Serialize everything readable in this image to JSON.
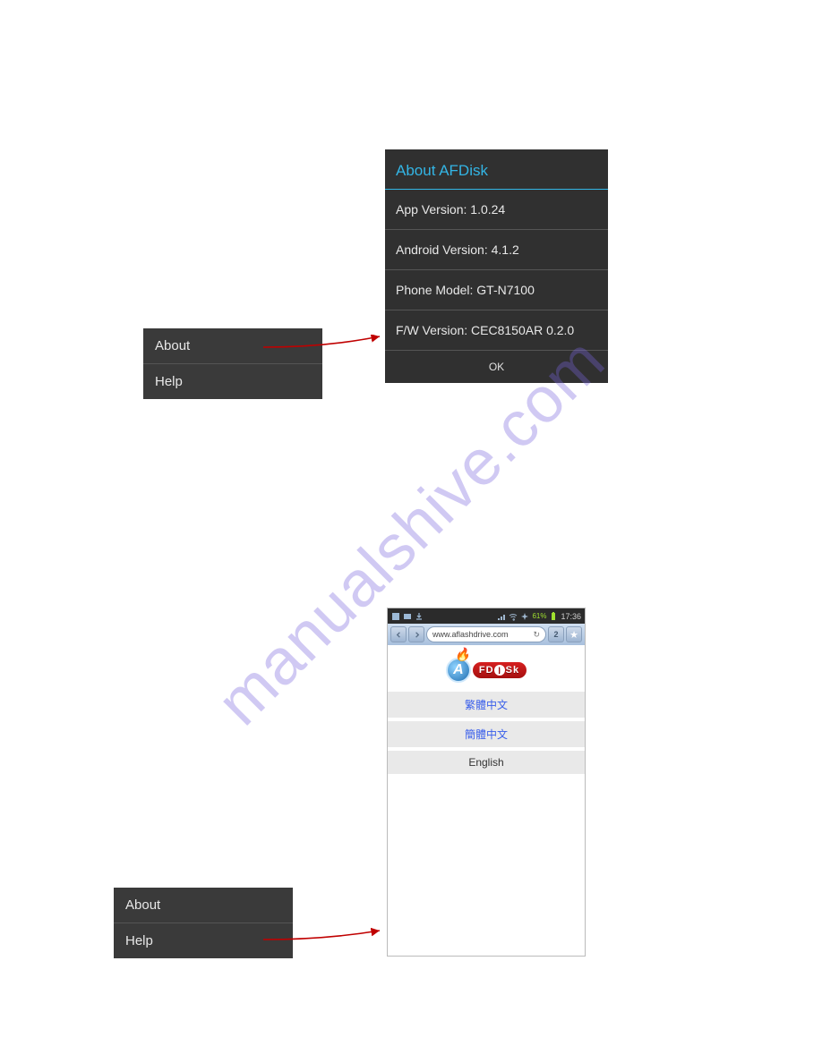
{
  "watermark": "manualshive.com",
  "menu": {
    "about": "About",
    "help": "Help"
  },
  "about_dialog": {
    "title": "About AFDisk",
    "rows": {
      "app_version_label": "App Version:",
      "app_version_value": "1.0.24",
      "android_version_label": "Android Version:",
      "android_version_value": "4.1.2",
      "phone_model_label": "Phone Model:",
      "phone_model_value": "GT-N7100",
      "fw_version_label": "F/W Version:",
      "fw_version_value": "CEC8150AR 0.2.0"
    },
    "ok": "OK"
  },
  "browser": {
    "status": {
      "battery": "61%",
      "time": "17:36"
    },
    "url": "www.aflashdrive.com",
    "tab_count": "2",
    "logo": {
      "letter": "A",
      "chars": [
        "F",
        "D",
        "i",
        "S",
        "k"
      ]
    },
    "languages": {
      "traditional": "繁體中文",
      "simplified": "簡體中文",
      "english": "English"
    }
  }
}
